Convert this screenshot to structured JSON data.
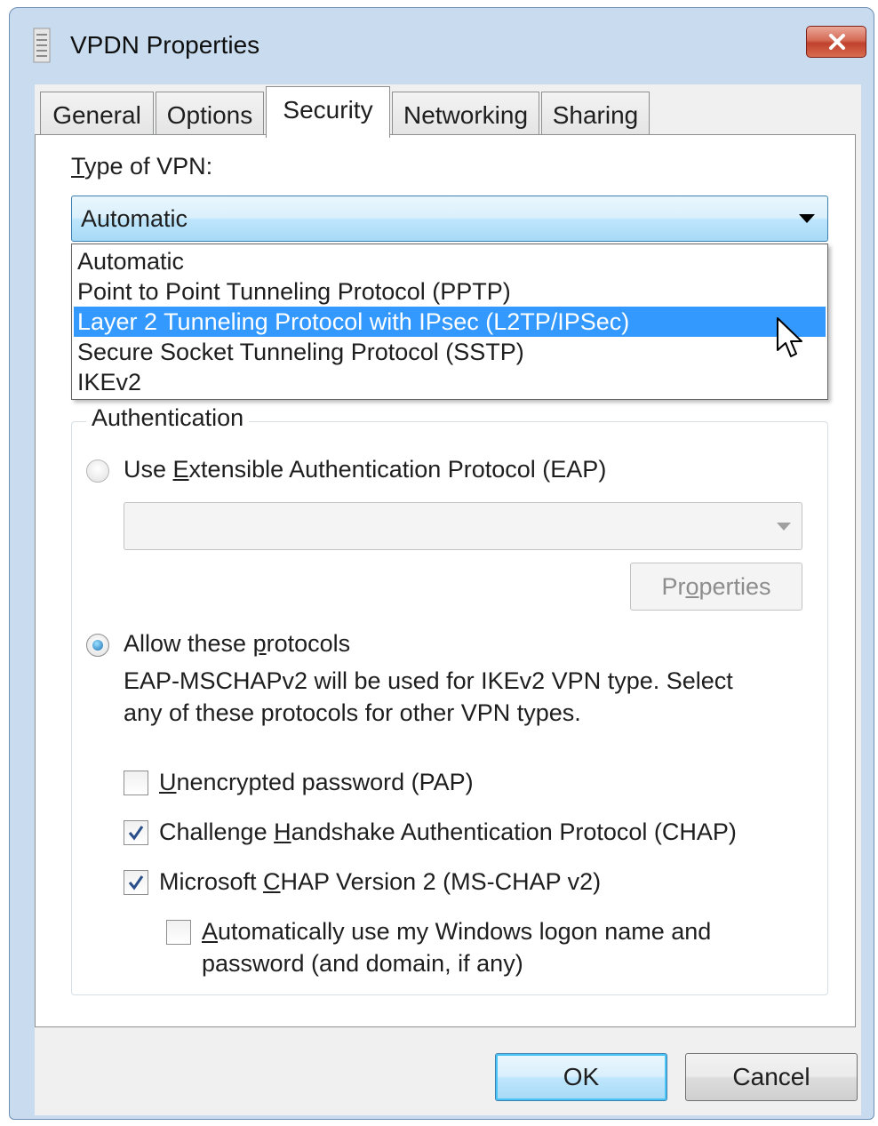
{
  "window": {
    "title": "VPDN Properties",
    "title_icon": "document-icon",
    "close_icon": "close-icon"
  },
  "tabs": [
    {
      "label": "General"
    },
    {
      "label": "Options"
    },
    {
      "label": "Security",
      "active": true
    },
    {
      "label": "Networking"
    },
    {
      "label": "Sharing"
    }
  ],
  "vpn_type": {
    "label_first": "T",
    "label_rest": "ype of VPN:",
    "selected": "Automatic",
    "options": [
      "Automatic",
      "Point to Point Tunneling Protocol (PPTP)",
      "Layer 2 Tunneling Protocol with IPsec (L2TP/IPSec)",
      "Secure Socket Tunneling Protocol (SSTP)",
      "IKEv2"
    ],
    "highlighted_index": 2
  },
  "authentication": {
    "title": "Authentication",
    "eap_radio": {
      "pre": "Use ",
      "key": "E",
      "post": "xtensible Authentication Protocol (EAP)",
      "checked": false
    },
    "eap_select_value": "",
    "properties_button": {
      "pre": "Pr",
      "key": "o",
      "post": "perties",
      "enabled": false
    },
    "allow_radio": {
      "pre": "Allow these ",
      "key": "p",
      "post": "rotocols",
      "checked": true
    },
    "description_line1": "EAP-MSCHAPv2 will be used for IKEv2 VPN type. Select",
    "description_line2": "any of these protocols for other VPN types.",
    "pap": {
      "pre": "",
      "key": "U",
      "post": "nencrypted password (PAP)",
      "checked": false
    },
    "chap": {
      "pre": "Challenge ",
      "key": "H",
      "post": "andshake Authentication Protocol (CHAP)",
      "checked": true
    },
    "mschap": {
      "pre": "Microsoft ",
      "key": "C",
      "post": "HAP Version 2 (MS-CHAP v2)",
      "checked": true
    },
    "auto_logon": {
      "pre": "",
      "key": "A",
      "post": "utomatically use my Windows logon name and",
      "line2": "password (and domain, if any)",
      "checked": false
    }
  },
  "buttons": {
    "ok": "OK",
    "cancel": "Cancel"
  },
  "colors": {
    "selection": "#3399ff",
    "title_bar": "#c9dcef",
    "close_button": "#c0412d"
  }
}
